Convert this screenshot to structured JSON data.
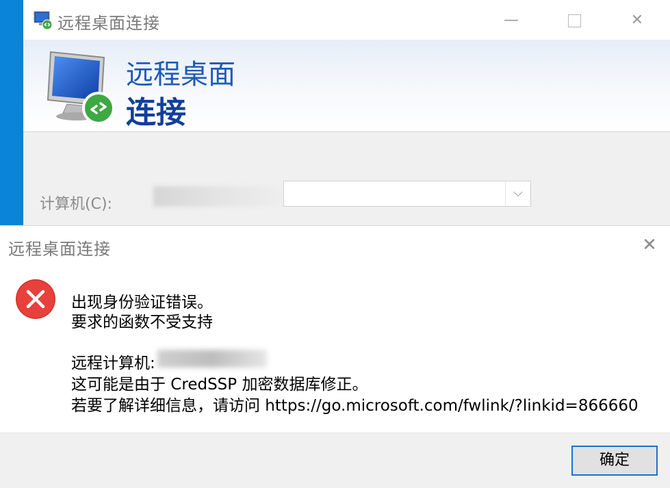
{
  "rdp": {
    "title": "远程桌面连接",
    "banner_line1": "远程桌面",
    "banner_line2": "连接",
    "computer_label": "计算机(C):",
    "min_glyph": "—",
    "close_glyph": "✕",
    "combo_arrow": "⌵"
  },
  "error_dialog": {
    "title": "远程桌面连接",
    "close_glyph": "✕",
    "line1": "出现身份验证错误。",
    "line2": "要求的函数不受支持",
    "line3": "远程计算机:",
    "line4": "这可能是由于 CredSSP 加密数据库修正。",
    "line5": "若要了解详细信息，请访问 https://go.microsoft.com/fwlink/?linkid=866660",
    "ok_label": "确定"
  },
  "colors": {
    "desktop_blue": "#0a84d8",
    "error_red": "#e8403a",
    "banner_text": "#1e5bb8",
    "focus_border": "#1e6fd0"
  },
  "icons": [
    "rdp-monitor-icon",
    "minimize-icon",
    "maximize-icon",
    "close-icon",
    "chevron-down-icon",
    "error-icon"
  ]
}
